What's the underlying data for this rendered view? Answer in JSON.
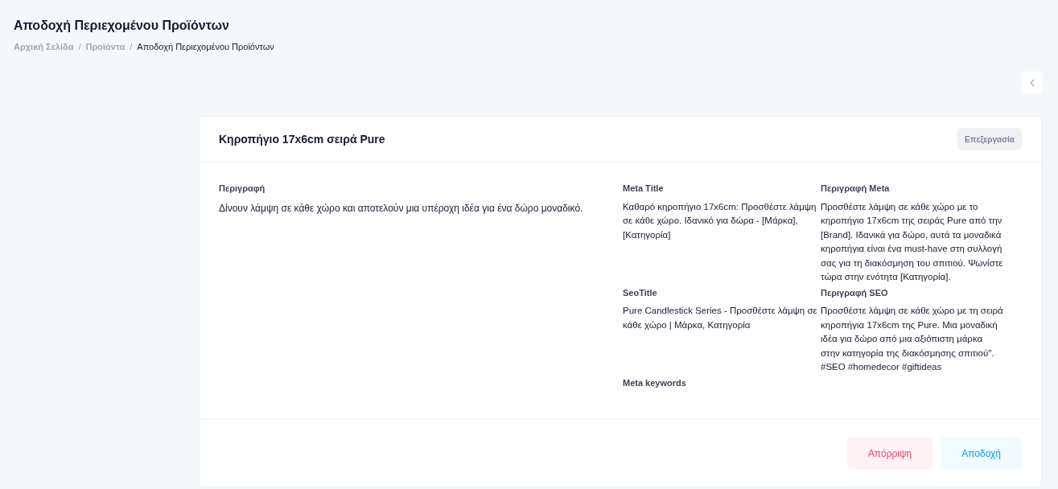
{
  "page_title": "Αποδοχή Περιεχομένου Προϊόντων",
  "breadcrumb_separator": "/",
  "breadcrumb": [
    {
      "label": "Αρχική Σελίδα",
      "current": false
    },
    {
      "label": "Προϊόντα",
      "current": false
    },
    {
      "label": "Αποδοχή Περιεχομένου Προϊόντων",
      "current": true
    }
  ],
  "card": {
    "title": "Κηροπήγιο 17x6cm σειρά Pure",
    "edit_button": "Επεξεργασία",
    "description": {
      "label": "Περιγραφή",
      "value": "Δίνουν λάμψη σε κάθε χώρο και αποτελούν μια υπέροχη ιδέα για ένα δώρο μοναδικό."
    },
    "fields": [
      {
        "label": "Meta Title",
        "value": "Καθαρό κηροπήγιο 17x6cm: Προσθέστε λάμψη σε κάθε χώρο. Ιδανικό για δώρα - [Μάρκα], [Κατηγορία]"
      },
      {
        "label": "Περιγραφή Meta",
        "value": "Προσθέστε λάμψη σε κάθε χώρο με το κηροπήγιο 17x6cm της σειράς Pure από την [Brand]. Ιδανικά για δώρο, αυτά τα μοναδικά κηροπήγια είναι ένα must-have στη συλλογή σας για τη διακόσμηση του σπιτιού. Ψωνίστε τώρα στην ενότητα [Κατηγορία]."
      },
      {
        "label": "SeoTitle",
        "value": "Pure Candlestick Series - Προσθέστε λάμψη σε κάθε χώρο | Μάρκα, Κατηγορία"
      },
      {
        "label": "Περιγραφή SEO",
        "value": "Προσθέστε λάμψη σε κάθε χώρο με τη σειρά κηροπήγια 17x6cm της Pure. Μια μοναδική ιδέα για δώρο από μια αξιόπιστη μάρκα στην κατηγορία της διακόσμησης σπιτιού\". #SEO #homedecor #giftideas"
      },
      {
        "label": "Meta keywords"
      }
    ],
    "buttons": [
      {
        "label": "Απόρριψη",
        "kind": "reject"
      },
      {
        "label": "Αποδοχή",
        "kind": "accept"
      }
    ]
  }
}
